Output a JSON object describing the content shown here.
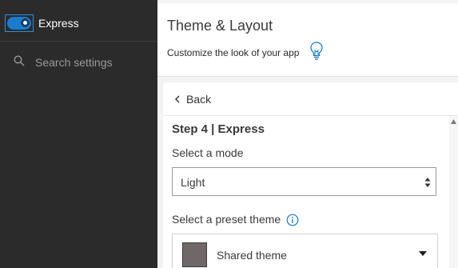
{
  "sidebar": {
    "toggle": {
      "on": true,
      "label": "Express"
    },
    "search": {
      "placeholder": "Search settings",
      "value": ""
    }
  },
  "header": {
    "title": "Theme & Layout",
    "subtitle": "Customize the look of your app",
    "tip_icon": "lightbulb-icon"
  },
  "panel": {
    "back_label": "Back",
    "step_title": "Step 4 | Express",
    "mode": {
      "label": "Select a mode",
      "value": "Light"
    },
    "preset": {
      "label": "Select a preset theme",
      "value": "Shared theme",
      "swatch_color": "#706868"
    }
  },
  "colors": {
    "sidebar_bg": "#2b2b2b",
    "accent": "#1a7bd0",
    "info": "#1a7bd0"
  }
}
